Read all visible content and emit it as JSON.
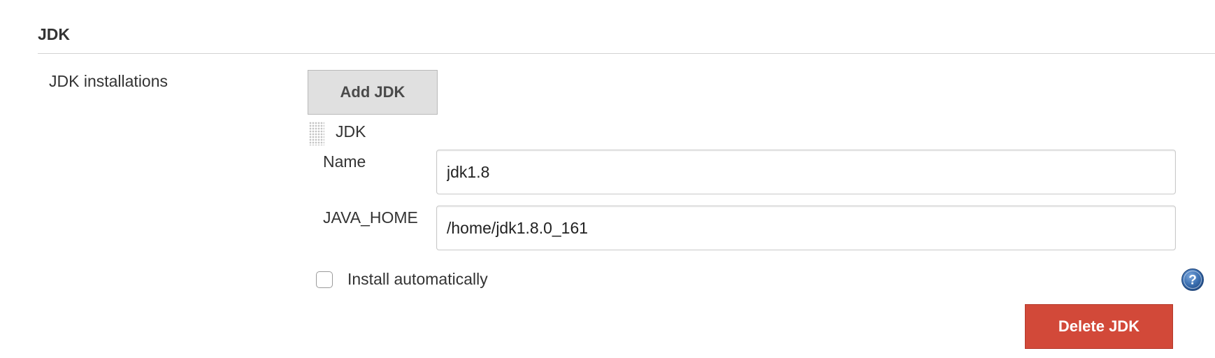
{
  "section": {
    "title": "JDK"
  },
  "setting": {
    "label": "JDK installations",
    "add_button_label": "Add JDK"
  },
  "installation": {
    "title": "JDK",
    "name_label": "Name",
    "name_value": "jdk1.8",
    "java_home_label": "JAVA_HOME",
    "java_home_value": "/home/jdk1.8.0_161",
    "install_auto_label": "Install automatically",
    "install_auto_checked": false,
    "delete_button_label": "Delete JDK"
  },
  "colors": {
    "delete_button": "#d24939",
    "add_button": "#e0e0e0",
    "help_icon": "#3b6fb0"
  },
  "icons": {
    "drag_handle": "drag-handle-icon",
    "help": "help-icon"
  }
}
